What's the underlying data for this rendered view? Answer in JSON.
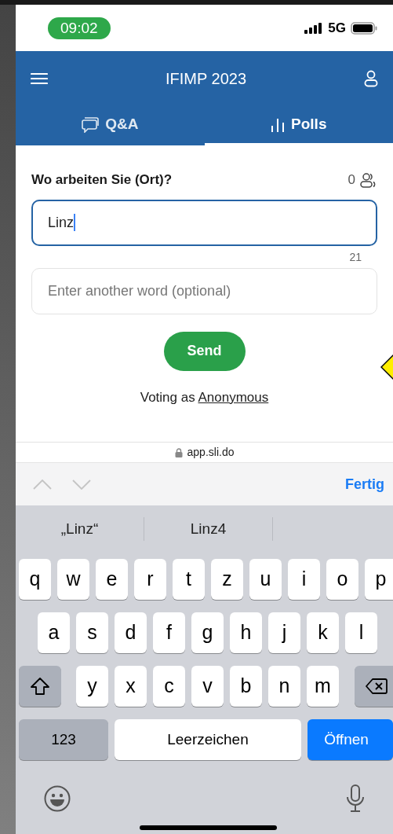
{
  "status_bar": {
    "time": "09:02",
    "network": "5G"
  },
  "header": {
    "title": "IFIMP 2023"
  },
  "tabs": [
    {
      "label": "Q&A",
      "selected": false
    },
    {
      "label": "Polls",
      "selected": true
    }
  ],
  "poll": {
    "question": "Wo arbeiten Sie (Ort)?",
    "participants": "0",
    "answer": {
      "value": "Linz",
      "focused": true
    },
    "remaining": "21",
    "extra_field": {
      "placeholder": "Enter another word (optional)"
    },
    "send": "Send",
    "voting_prefix": "Voting as",
    "voting_name": "Anonymous"
  },
  "browser": {
    "url": "app.sli.do",
    "done": "Fertig"
  },
  "keyboard": {
    "suggestions": [
      "„Linz“",
      "Linz4"
    ],
    "letter_rows": [
      [
        "q",
        "w",
        "e",
        "r",
        "t",
        "z",
        "u",
        "i",
        "o",
        "p"
      ],
      [
        "a",
        "s",
        "d",
        "f",
        "g",
        "h",
        "j",
        "k",
        "l"
      ],
      [
        "y",
        "x",
        "c",
        "v",
        "b",
        "n",
        "m"
      ]
    ],
    "number_key": "123",
    "space_key": "Leerzeichen",
    "return_key": "Öffnen"
  }
}
